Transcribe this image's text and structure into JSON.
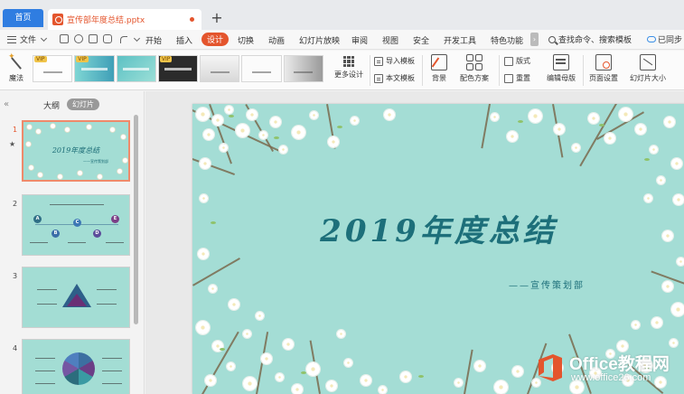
{
  "tabs": {
    "home_label": "首页",
    "doc_label": "宣传部年度总结.pptx",
    "new_tab": "+"
  },
  "menu": {
    "file_label": "文件",
    "items": [
      "开始",
      "插入",
      "设计",
      "切换",
      "动画",
      "幻灯片放映",
      "审阅",
      "视图",
      "安全",
      "开发工具",
      "特色功能"
    ],
    "active_item": "设计",
    "more": "›",
    "search_label": "查找命令、搜索模板",
    "sync_label": "已同步"
  },
  "ribbon": {
    "magic_label": "魔法",
    "vip_badge": "VIP",
    "more_design_label": "更多设计",
    "import_template": "导入模板",
    "body_template": "本文模板",
    "background_label": "背景",
    "color_scheme_label": "配色方案",
    "layout_label": "版式",
    "reset_label": "重置",
    "edit_master_label": "编辑母版",
    "page_setup_label": "页面设置",
    "slide_size_label": "幻灯片大小"
  },
  "panel": {
    "outline_tab": "大纲",
    "slides_tab": "幻灯片",
    "slide_numbers": [
      "1",
      "2",
      "3",
      "4"
    ],
    "star": "★",
    "collapse": "«",
    "dot_letters": [
      "A",
      "B",
      "C",
      "D",
      "E"
    ]
  },
  "slide": {
    "title": "2019年度总结",
    "subtitle": "——宣传策划部"
  },
  "watermark": {
    "brand": "Office教程网",
    "url": "www.office26.com"
  },
  "colors": {
    "accent": "#e4552d",
    "slide_bg": "#a4ddd5",
    "title_color": "#1d6f7a"
  }
}
